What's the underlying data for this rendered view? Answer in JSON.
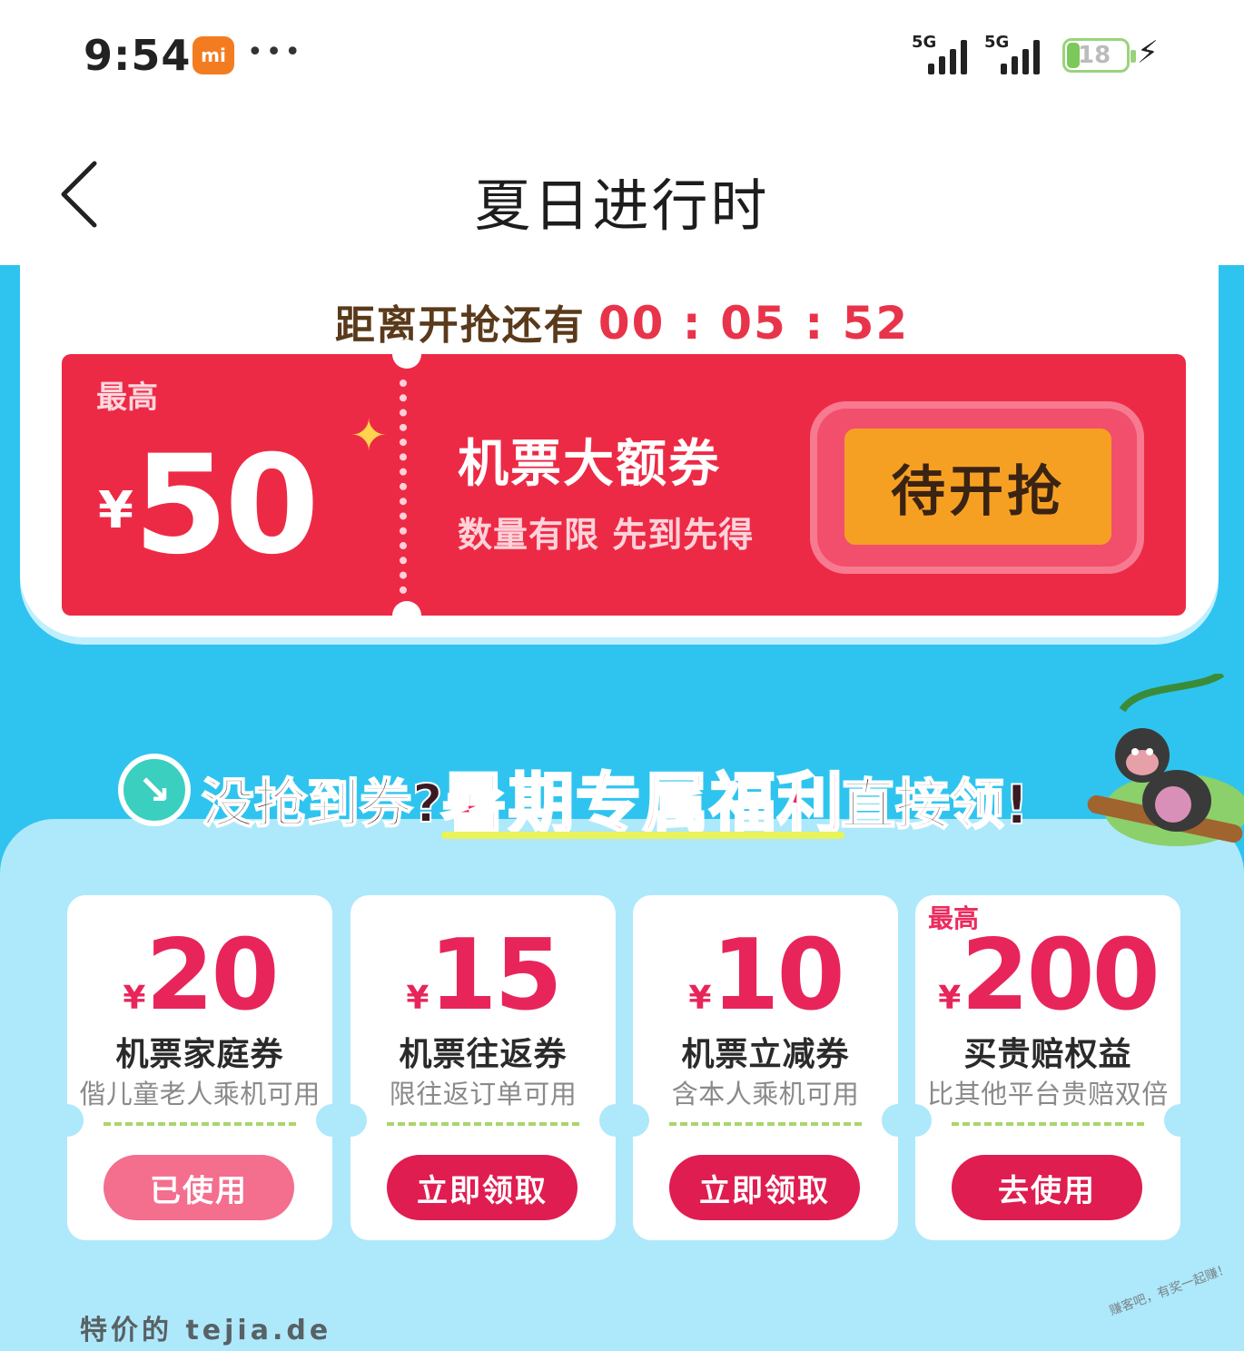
{
  "status_bar": {
    "time": "9:54",
    "badge": "mi",
    "dots": "•••",
    "network1": "5G",
    "network2": "5G",
    "battery": "18"
  },
  "nav": {
    "title": "夏日进行时"
  },
  "countdown": {
    "label": "距离开抢还有",
    "time": "00 : 05 : 52"
  },
  "main_coupon": {
    "top_label": "最高",
    "currency": "¥",
    "amount": "50",
    "name": "机票大额券",
    "subtitle": "数量有限 先到先得",
    "button_label": "待开抢"
  },
  "welfare": {
    "part1": "没抢到券?",
    "part2": "暑期专属福利",
    "part3": "直接领!"
  },
  "coupons": [
    {
      "top_label": "",
      "currency": "¥",
      "amount": "20",
      "name": "机票家庭券",
      "desc": "偕儿童老人乘机可用",
      "button": "已使用"
    },
    {
      "top_label": "",
      "currency": "¥",
      "amount": "15",
      "name": "机票往返券",
      "desc": "限往返订单可用",
      "button": "立即领取"
    },
    {
      "top_label": "",
      "currency": "¥",
      "amount": "10",
      "name": "机票立减券",
      "desc": "含本人乘机可用",
      "button": "立即领取"
    },
    {
      "top_label": "最高",
      "currency": "¥",
      "amount": "200",
      "name": "买贵赔权益",
      "desc": "比其他平台贵赔双倍",
      "button": "去使用"
    }
  ],
  "watermark": "特价的 tejia.de",
  "watermark2": "赚客吧，有奖一起赚！"
}
